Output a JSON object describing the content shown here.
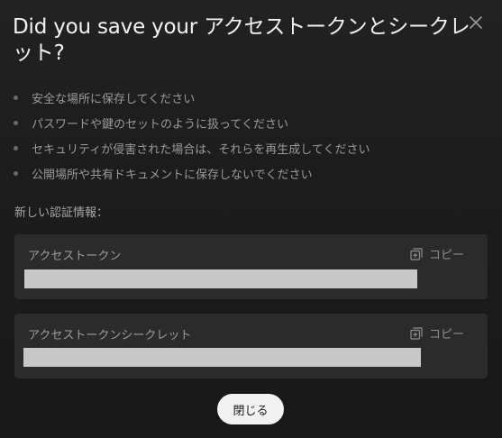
{
  "dialog": {
    "title": "Did you save your アクセストークンとシークレット?",
    "close_icon": "close-icon"
  },
  "tips": [
    "安全な場所に保存してください",
    "パスワードや鍵のセットのように扱ってください",
    "セキュリティが侵害された場合は、それらを再生成してください",
    "公開場所や共有ドキュメントに保存しないでください"
  ],
  "credentials": {
    "section_label": "新しい認証情報：",
    "access_token": {
      "label": "アクセストークン",
      "copy_label": "コピー",
      "value_state": "redacted"
    },
    "access_token_secret": {
      "label": "アクセストークンシークレット",
      "copy_label": "コピー",
      "value_state": "redacted"
    }
  },
  "footer": {
    "close_label": "閉じる"
  },
  "colors": {
    "background": "#1c1c1c",
    "card": "#2b2b2b",
    "redaction": "#c8c8c8",
    "button_bg": "#f2f2f2"
  }
}
